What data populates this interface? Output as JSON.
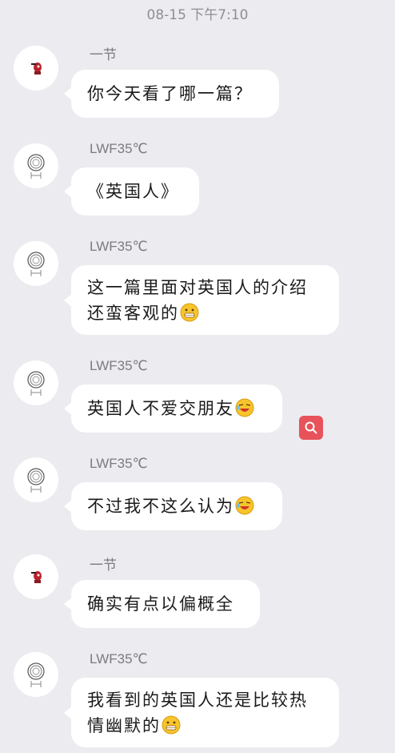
{
  "header": {
    "timestamp": "08-15 下午7:10"
  },
  "messages": [
    {
      "sender": "一节",
      "avatar": "red-figure-avatar",
      "text": "你今天看了哪一篇？",
      "emoji": ""
    },
    {
      "sender": "LWF35℃",
      "avatar": "scribble-avatar",
      "text": "《英国人》",
      "emoji": ""
    },
    {
      "sender": "LWF35℃",
      "avatar": "scribble-avatar",
      "text": "这一篇里面对英国人的介绍还蛮客观的",
      "emoji": "grin-emoji"
    },
    {
      "sender": "LWF35℃",
      "avatar": "scribble-avatar",
      "text": "英国人不爱交朋友",
      "emoji": "laugh-cry-emoji"
    },
    {
      "sender": "LWF35℃",
      "avatar": "scribble-avatar",
      "text": "不过我不这么认为",
      "emoji": "laugh-cry-emoji"
    },
    {
      "sender": "一节",
      "avatar": "red-figure-avatar",
      "text": "确实有点以偏概全",
      "emoji": ""
    },
    {
      "sender": "LWF35℃",
      "avatar": "scribble-avatar",
      "text": "我看到的英国人还是比较热情幽默的",
      "emoji": "grin-emoji"
    }
  ],
  "colors": {
    "background": "#ececf0",
    "bubble": "#ffffff",
    "search_accent": "#e8525a"
  },
  "floating": {
    "icon": "search-icon"
  }
}
